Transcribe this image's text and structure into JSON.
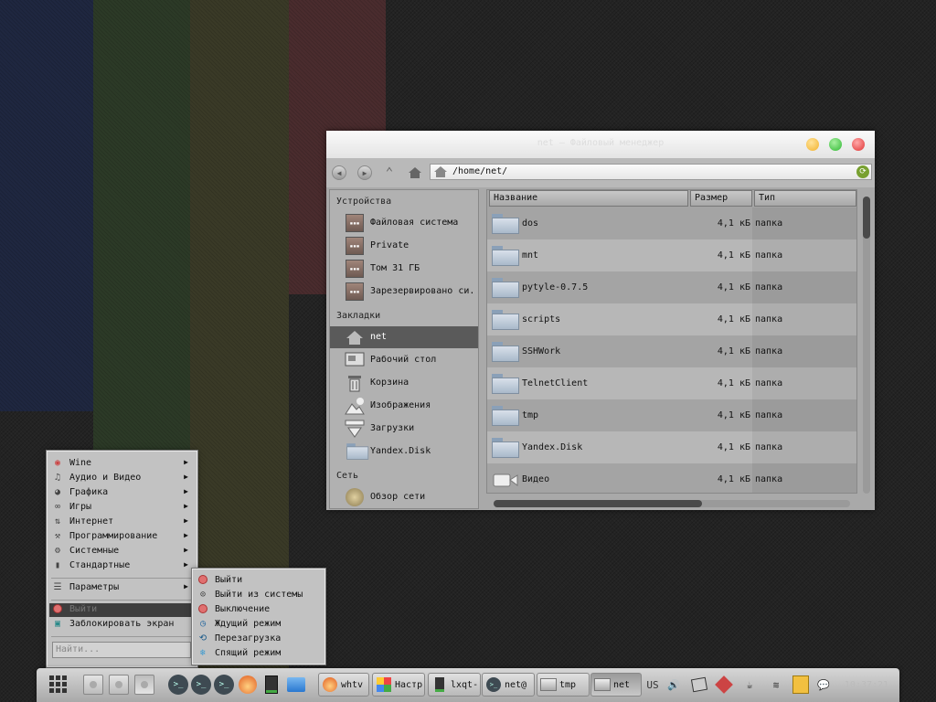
{
  "colors": {
    "accent_selected": "#5a5a5a",
    "close": "#e03434",
    "maximize": "#2fb832",
    "minimize": "#f2b12a"
  },
  "window": {
    "title": "net – Файловый менеджер",
    "path": "/home/net/",
    "sidebar": {
      "devices_header": "Устройства",
      "devices": [
        {
          "label": "Файловая система",
          "icon": "hdd-icon"
        },
        {
          "label": "Private",
          "icon": "hdd-icon"
        },
        {
          "label": "Том 31 ГБ",
          "icon": "hdd-icon"
        },
        {
          "label": "Зарезервировано си...",
          "icon": "hdd-icon"
        }
      ],
      "bookmarks_header": "Закладки",
      "bookmarks": [
        {
          "label": "net",
          "icon": "home-icon",
          "selected": true
        },
        {
          "label": "Рабочий стол",
          "icon": "desktop-icon"
        },
        {
          "label": "Корзина",
          "icon": "trash-icon"
        },
        {
          "label": "Изображения",
          "icon": "pictures-icon"
        },
        {
          "label": "Загрузки",
          "icon": "downloads-icon"
        },
        {
          "label": "Yandex.Disk",
          "icon": "folder-icon"
        }
      ],
      "network_header": "Сеть",
      "network": [
        {
          "label": "Обзор сети",
          "icon": "network-icon"
        }
      ]
    },
    "columns": {
      "name": "Название",
      "size": "Размер",
      "type": "Тип"
    },
    "files": [
      {
        "name": "dos",
        "size": "4,1 кБ",
        "type": "папка"
      },
      {
        "name": "mnt",
        "size": "4,1 кБ",
        "type": "папка"
      },
      {
        "name": "pytyle-0.7.5",
        "size": "4,1 кБ",
        "type": "папка"
      },
      {
        "name": "scripts",
        "size": "4,1 кБ",
        "type": "папка"
      },
      {
        "name": "SSHWork",
        "size": "4,1 кБ",
        "type": "папка"
      },
      {
        "name": "TelnetClient",
        "size": "4,1 кБ",
        "type": "папка"
      },
      {
        "name": "tmp",
        "size": "4,1 кБ",
        "type": "папка"
      },
      {
        "name": "Yandex.Disk",
        "size": "4,1 кБ",
        "type": "папка"
      },
      {
        "name": "Видео",
        "size": "4,1 кБ",
        "type": "папка"
      }
    ]
  },
  "menu": {
    "items": [
      {
        "label": "Wine",
        "icon": "wine-icon",
        "submenu": true
      },
      {
        "label": "Аудио и Видео",
        "icon": "music-icon",
        "submenu": true
      },
      {
        "label": "Графика",
        "icon": "palette-icon",
        "submenu": true
      },
      {
        "label": "Игры",
        "icon": "gamepad-icon",
        "submenu": true
      },
      {
        "label": "Интернет",
        "icon": "network-icon",
        "submenu": true
      },
      {
        "label": "Программирование",
        "icon": "wrench-icon",
        "submenu": true
      },
      {
        "label": "Системные",
        "icon": "gears-icon",
        "submenu": true
      },
      {
        "label": "Стандартные",
        "icon": "accessories-icon",
        "submenu": true
      }
    ],
    "settings": "Параметры",
    "logout": "Выйти",
    "lock": "Заблокировать экран",
    "search_placeholder": "Найти..."
  },
  "submenu": {
    "items": [
      {
        "label": "Выйти",
        "icon": "power-icon"
      },
      {
        "label": "Выйти из системы",
        "icon": "logout-icon"
      },
      {
        "label": "Выключение",
        "icon": "shutdown-icon"
      },
      {
        "label": "Ждущий режим",
        "icon": "clock-icon"
      },
      {
        "label": "Перезагрузка",
        "icon": "reboot-icon"
      },
      {
        "label": "Спящий режим",
        "icon": "snowflake-icon"
      }
    ]
  },
  "taskbar": {
    "tasks": [
      {
        "label": "whtv",
        "icon": "browser-icon"
      },
      {
        "label": "Настр",
        "icon": "settings-icon"
      },
      {
        "label": "lxqt-",
        "icon": "monitor-icon"
      },
      {
        "label": "net@",
        "icon": "terminal-icon"
      },
      {
        "label": "tmp",
        "icon": "folder-icon"
      },
      {
        "label": "net",
        "icon": "folder-icon",
        "active": true
      }
    ],
    "keyboard_layout": "US",
    "clock": "10:37:21"
  }
}
